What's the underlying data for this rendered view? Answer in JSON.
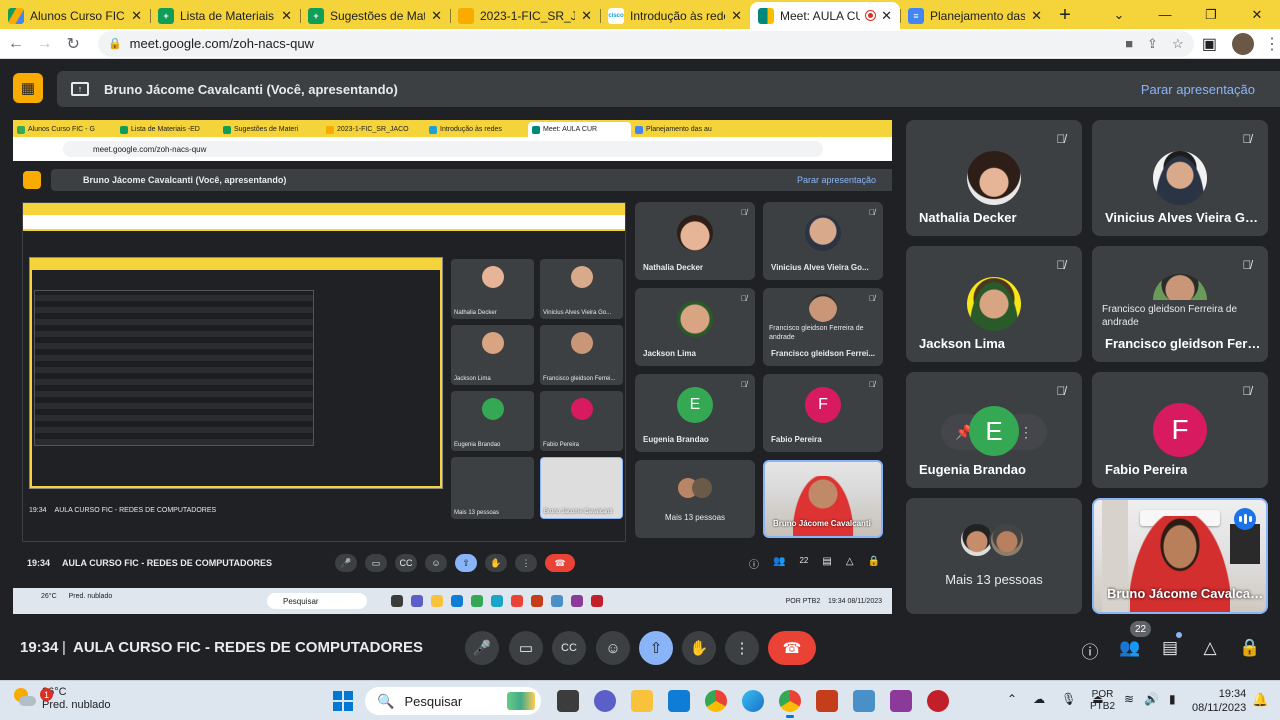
{
  "browser": {
    "tabs": [
      {
        "title": "Alunos Curso FIC - G",
        "fav_color": "#34a853",
        "active": false
      },
      {
        "title": "Lista de Materiais -ED",
        "fav_color": "#0f9d58",
        "active": false
      },
      {
        "title": "Sugestões de Materi",
        "fav_color": "#0f9d58",
        "active": false
      },
      {
        "title": "2023-1-FIC_SR_JACO",
        "fav_color": "#f9ab00",
        "active": false
      },
      {
        "title": "Introdução às redes",
        "fav_color": "#7b1fa2",
        "active": false
      },
      {
        "title": "Meet: AULA CUR",
        "fav_color": "#00897b",
        "active": true
      },
      {
        "title": "Planejamento das au",
        "fav_color": "#4285f4",
        "active": false
      }
    ],
    "new_tab": "+",
    "url": "meet.google.com/zoh-nacs-quw"
  },
  "meet": {
    "presenting_label": "Bruno Jácome Cavalcanti (Você, apresentando)",
    "stop_presenting": "Parar apresentação",
    "time": "19:34",
    "separator": "|",
    "meeting_name": "AULA CURSO FIC - REDES DE COMPUTADORES",
    "people_count": "22"
  },
  "participants": [
    {
      "name": "Nathalia Decker"
    },
    {
      "name": "Vinicius Alves Vieira Go..."
    },
    {
      "name": "Jackson Lima"
    },
    {
      "name": "Francisco gleidson Ferrei...",
      "subtitle": "Francisco gleidson Ferreira de andrade"
    },
    {
      "name": "Eugenia Brandao",
      "initial": "E"
    },
    {
      "name": "Fabio Pereira",
      "initial": "F"
    },
    {
      "more": "Mais 13 pessoas"
    },
    {
      "name": "Bruno Jácome Cavalcanti"
    }
  ],
  "shared_screen": {
    "presenting_label": "Bruno Jácome Cavalcanti (Você, apresentando)",
    "stop_presenting": "Parar apresentação",
    "url": "meet.google.com/zoh-nacs-quw",
    "time": "19:34",
    "meeting_name": "AULA CURSO FIC - REDES DE COMPUTADORES",
    "people_count": "22",
    "tiles": [
      {
        "name": "Nathalia Decker"
      },
      {
        "name": "Vinicius Alves Vieira Go..."
      },
      {
        "name": "Jackson Lima"
      },
      {
        "name": "Francisco gleidson Ferrei...",
        "subtitle": "Francisco gleidson Ferreira de andrade"
      },
      {
        "name": "Eugenia Brandao",
        "initial": "E"
      },
      {
        "name": "Fabio Pereira",
        "initial": "F"
      },
      {
        "more": "Mais 13 pessoas"
      },
      {
        "name": "Bruno Jácome Cavalcanti"
      }
    ],
    "taskbar": {
      "temp": "26°C",
      "weather": "Pred. nublado",
      "search": "Pesquisar",
      "lang1": "POR",
      "lang2": "PTB2",
      "time": "19:34",
      "date": "08/11/2023"
    }
  },
  "taskbar": {
    "weather_badge": "1",
    "temp": "26°C",
    "weather": "Pred. nublado",
    "search": "Pesquisar",
    "lang1": "POR",
    "lang2": "PTB2",
    "time": "19:34",
    "date": "08/11/2023",
    "apps": [
      {
        "name": "task-view",
        "color": "#3c3c3c"
      },
      {
        "name": "chat",
        "color": "#5b5fc7"
      },
      {
        "name": "file-explorer",
        "color": "#f9c23c"
      },
      {
        "name": "store",
        "color": "#0f7dd6"
      },
      {
        "name": "chrome",
        "color": "#34a853"
      },
      {
        "name": "edge",
        "color": "#1aa4c8"
      },
      {
        "name": "chrome-active",
        "color": "#ea4335"
      },
      {
        "name": "powerpoint",
        "color": "#c43e1c"
      },
      {
        "name": "notepad",
        "color": "#4a90c8"
      },
      {
        "name": "winrar",
        "color": "#8b3a9a"
      },
      {
        "name": "app-red",
        "color": "#c21f2a"
      }
    ]
  }
}
